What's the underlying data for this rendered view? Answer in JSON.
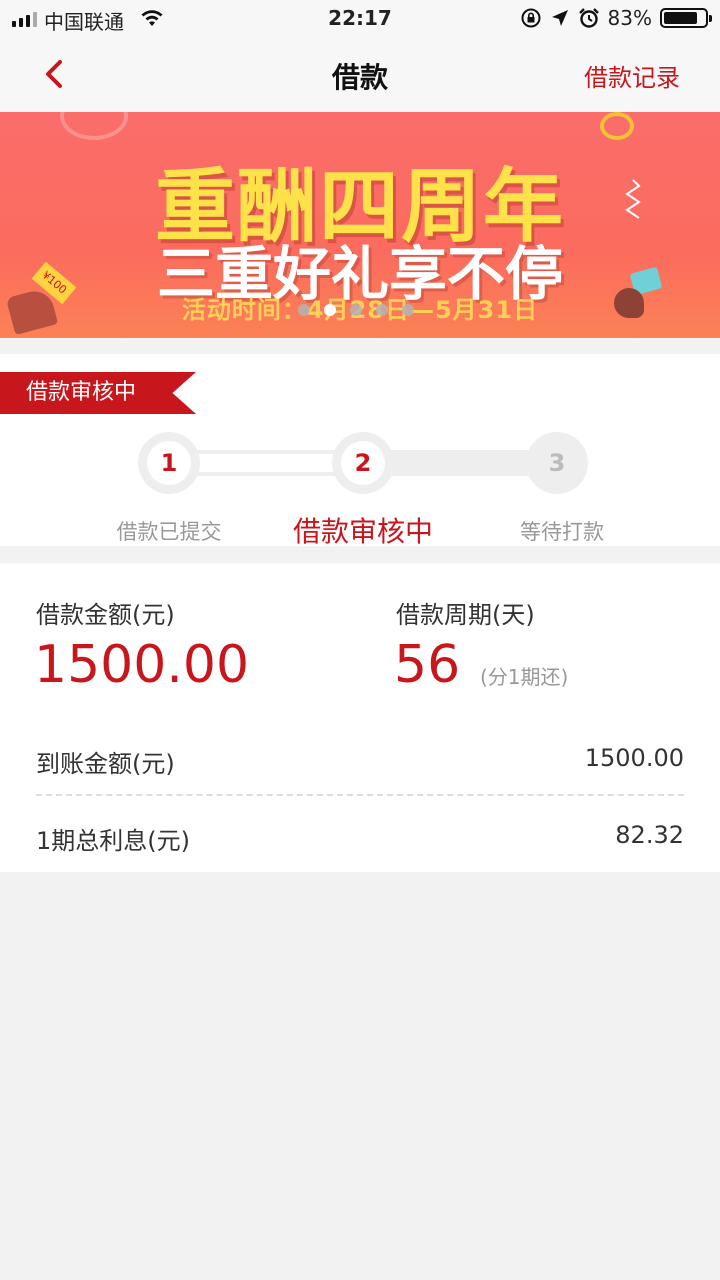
{
  "status_bar": {
    "carrier": "中国联通",
    "time": "22:17",
    "battery": "83%",
    "battery_level": 0.83
  },
  "nav": {
    "title": "借款",
    "right_link": "借款记录"
  },
  "banner": {
    "headline": "重酬四周年",
    "subheadline": "三重好礼享不停",
    "activity_time": "活动时间：4月28日—5月31日",
    "coupon_text": "¥100",
    "page_count": 5,
    "active_page": 2
  },
  "review": {
    "tag": "借款审核中",
    "steps": [
      {
        "number": "1",
        "label": "借款已提交"
      },
      {
        "number": "2",
        "label": "借款审核中"
      },
      {
        "number": "3",
        "label": "等待打款"
      }
    ]
  },
  "loan": {
    "amount_label": "借款金额(元)",
    "amount_value": "1500.00",
    "period_label": "借款周期(天)",
    "period_value": "56",
    "period_note": "(分1期还)",
    "received_label": "到账金额(元)",
    "received_value": "1500.00",
    "interest_label": "1期总利息(元)",
    "interest_value": "82.32"
  },
  "colors": {
    "accent": "#c8161d",
    "banner_bg": "#fb6d6b",
    "banner_headline": "#ffe14a"
  }
}
